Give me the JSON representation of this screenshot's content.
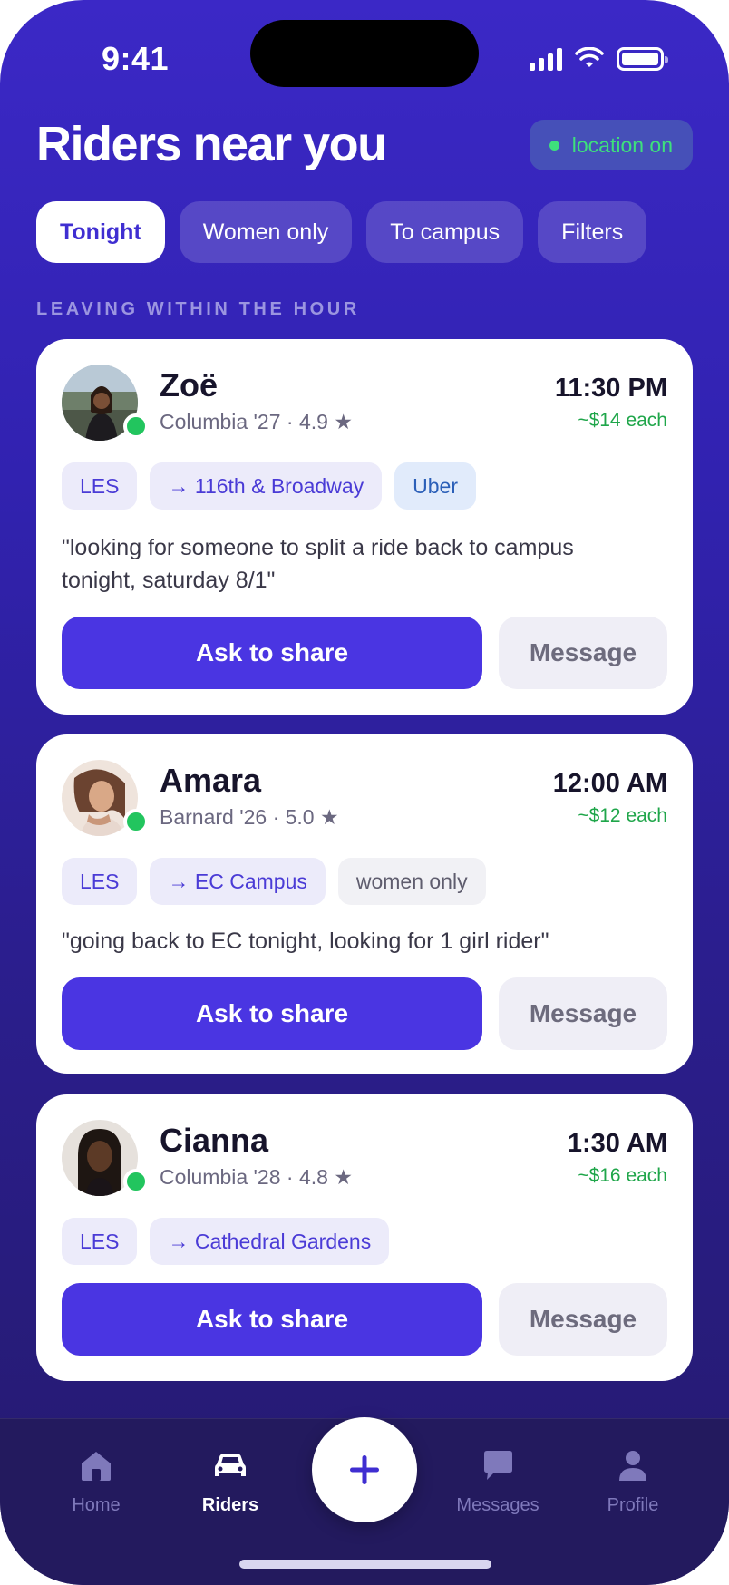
{
  "status_bar": {
    "time": "9:41"
  },
  "header": {
    "title": "Riders near you",
    "location_status": "location on"
  },
  "filters": [
    {
      "label": "Tonight",
      "active": true
    },
    {
      "label": "Women only",
      "active": false
    },
    {
      "label": "To campus",
      "active": false
    },
    {
      "label": "Filters",
      "active": false
    }
  ],
  "section_label": "LEAVING WITHIN THE HOUR",
  "riders": [
    {
      "name": "Zoë",
      "meta": "Columbia '27 · 4.9 ★",
      "time": "11:30 PM",
      "price": "~$14 each",
      "tags": [
        "LES",
        "→ 116th & Broadway",
        "Uber"
      ],
      "quote": "\"looking for someone to split a ride back to campus tonight, saturday 8/1\"",
      "primary_action": "Ask to share",
      "secondary_action": "Message"
    },
    {
      "name": "Amara",
      "meta": "Barnard '26 · 5.0 ★",
      "time": "12:00 AM",
      "price": "~$12 each",
      "tags": [
        "LES",
        "→ EC Campus",
        "women only"
      ],
      "quote": "\"going back to EC tonight, looking for 1 girl rider\"",
      "primary_action": "Ask to share",
      "secondary_action": "Message"
    },
    {
      "name": "Cianna",
      "meta": "Columbia '28 · 4.8 ★",
      "time": "1:30 AM",
      "price": "~$16 each",
      "tags": [
        "LES",
        "→ Cathedral Gardens"
      ],
      "primary_action": "Ask to share",
      "secondary_action": "Message"
    }
  ],
  "tabbar": {
    "items": [
      {
        "label": "Home",
        "icon": "home-icon",
        "active": false
      },
      {
        "label": "Riders",
        "icon": "car-icon",
        "active": true
      },
      {
        "label": "Messages",
        "icon": "chat-icon",
        "active": false
      },
      {
        "label": "Profile",
        "icon": "person-icon",
        "active": false
      }
    ],
    "fab_icon": "plus-icon"
  },
  "colors": {
    "accent": "#4a35e2",
    "online": "#22c55e",
    "price": "#1fa64a"
  }
}
